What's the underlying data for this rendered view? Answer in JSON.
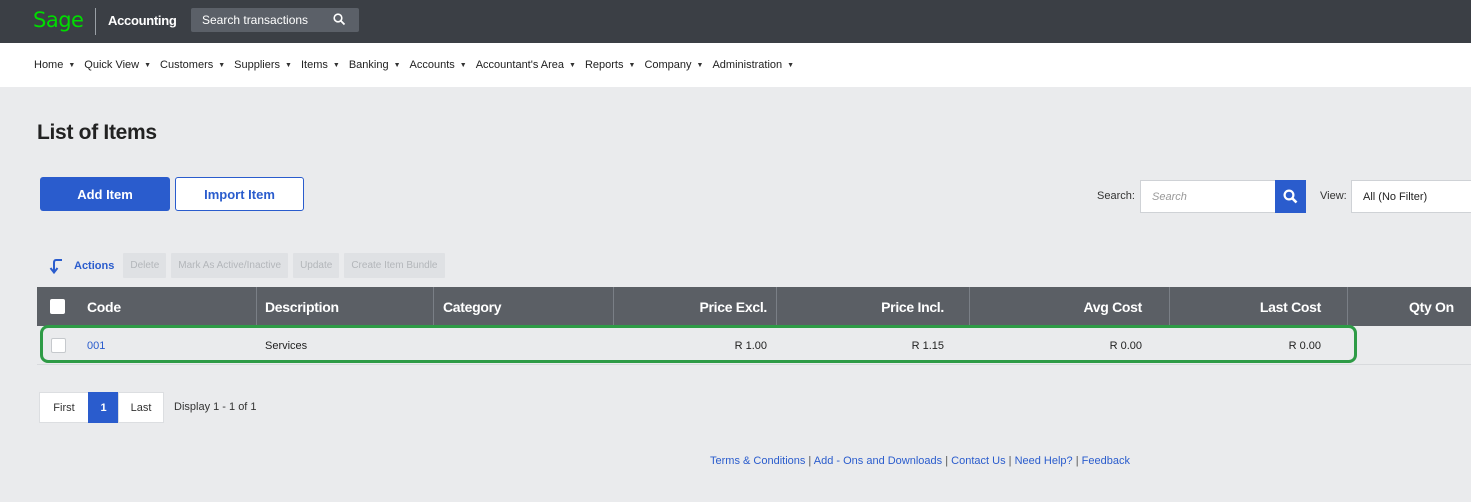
{
  "header": {
    "logo_text": "Sage",
    "product": "Accounting",
    "search_placeholder": "Search transactions"
  },
  "nav": [
    {
      "label": "Home"
    },
    {
      "label": "Quick View"
    },
    {
      "label": "Customers"
    },
    {
      "label": "Suppliers"
    },
    {
      "label": "Items"
    },
    {
      "label": "Banking"
    },
    {
      "label": "Accounts"
    },
    {
      "label": "Accountant's Area"
    },
    {
      "label": "Reports"
    },
    {
      "label": "Company"
    },
    {
      "label": "Administration"
    }
  ],
  "page": {
    "title": "List of Items",
    "add_button": "Add Item",
    "import_button": "Import Item",
    "search_label": "Search:",
    "search_placeholder": "Search",
    "view_label": "View:",
    "view_value": "All (No Filter)"
  },
  "actions": {
    "label": "Actions",
    "buttons": [
      "Delete",
      "Mark As Active/Inactive",
      "Update",
      "Create Item Bundle"
    ]
  },
  "table": {
    "columns": [
      "Code",
      "Description",
      "Category",
      "Price Excl.",
      "Price Incl.",
      "Avg Cost",
      "Last Cost",
      "Qty On"
    ],
    "rows": [
      {
        "code": "001",
        "description": "Services",
        "category": "",
        "price_excl": "R 1.00",
        "price_incl": "R 1.15",
        "avg_cost": "R 0.00",
        "last_cost": "R 0.00",
        "qty": ""
      }
    ]
  },
  "pagination": {
    "first": "First",
    "current": "1",
    "last": "Last",
    "info": "Display 1 - 1 of 1"
  },
  "footer": {
    "links": [
      "Terms & Conditions",
      "Add - Ons and Downloads",
      "Contact Us",
      "Need Help?",
      "Feedback"
    ],
    "separator": " | "
  },
  "colors": {
    "accent": "#2a5ccd",
    "topbar": "#3b3f45",
    "logo": "#00dc00",
    "highlight": "#2e9b46"
  }
}
